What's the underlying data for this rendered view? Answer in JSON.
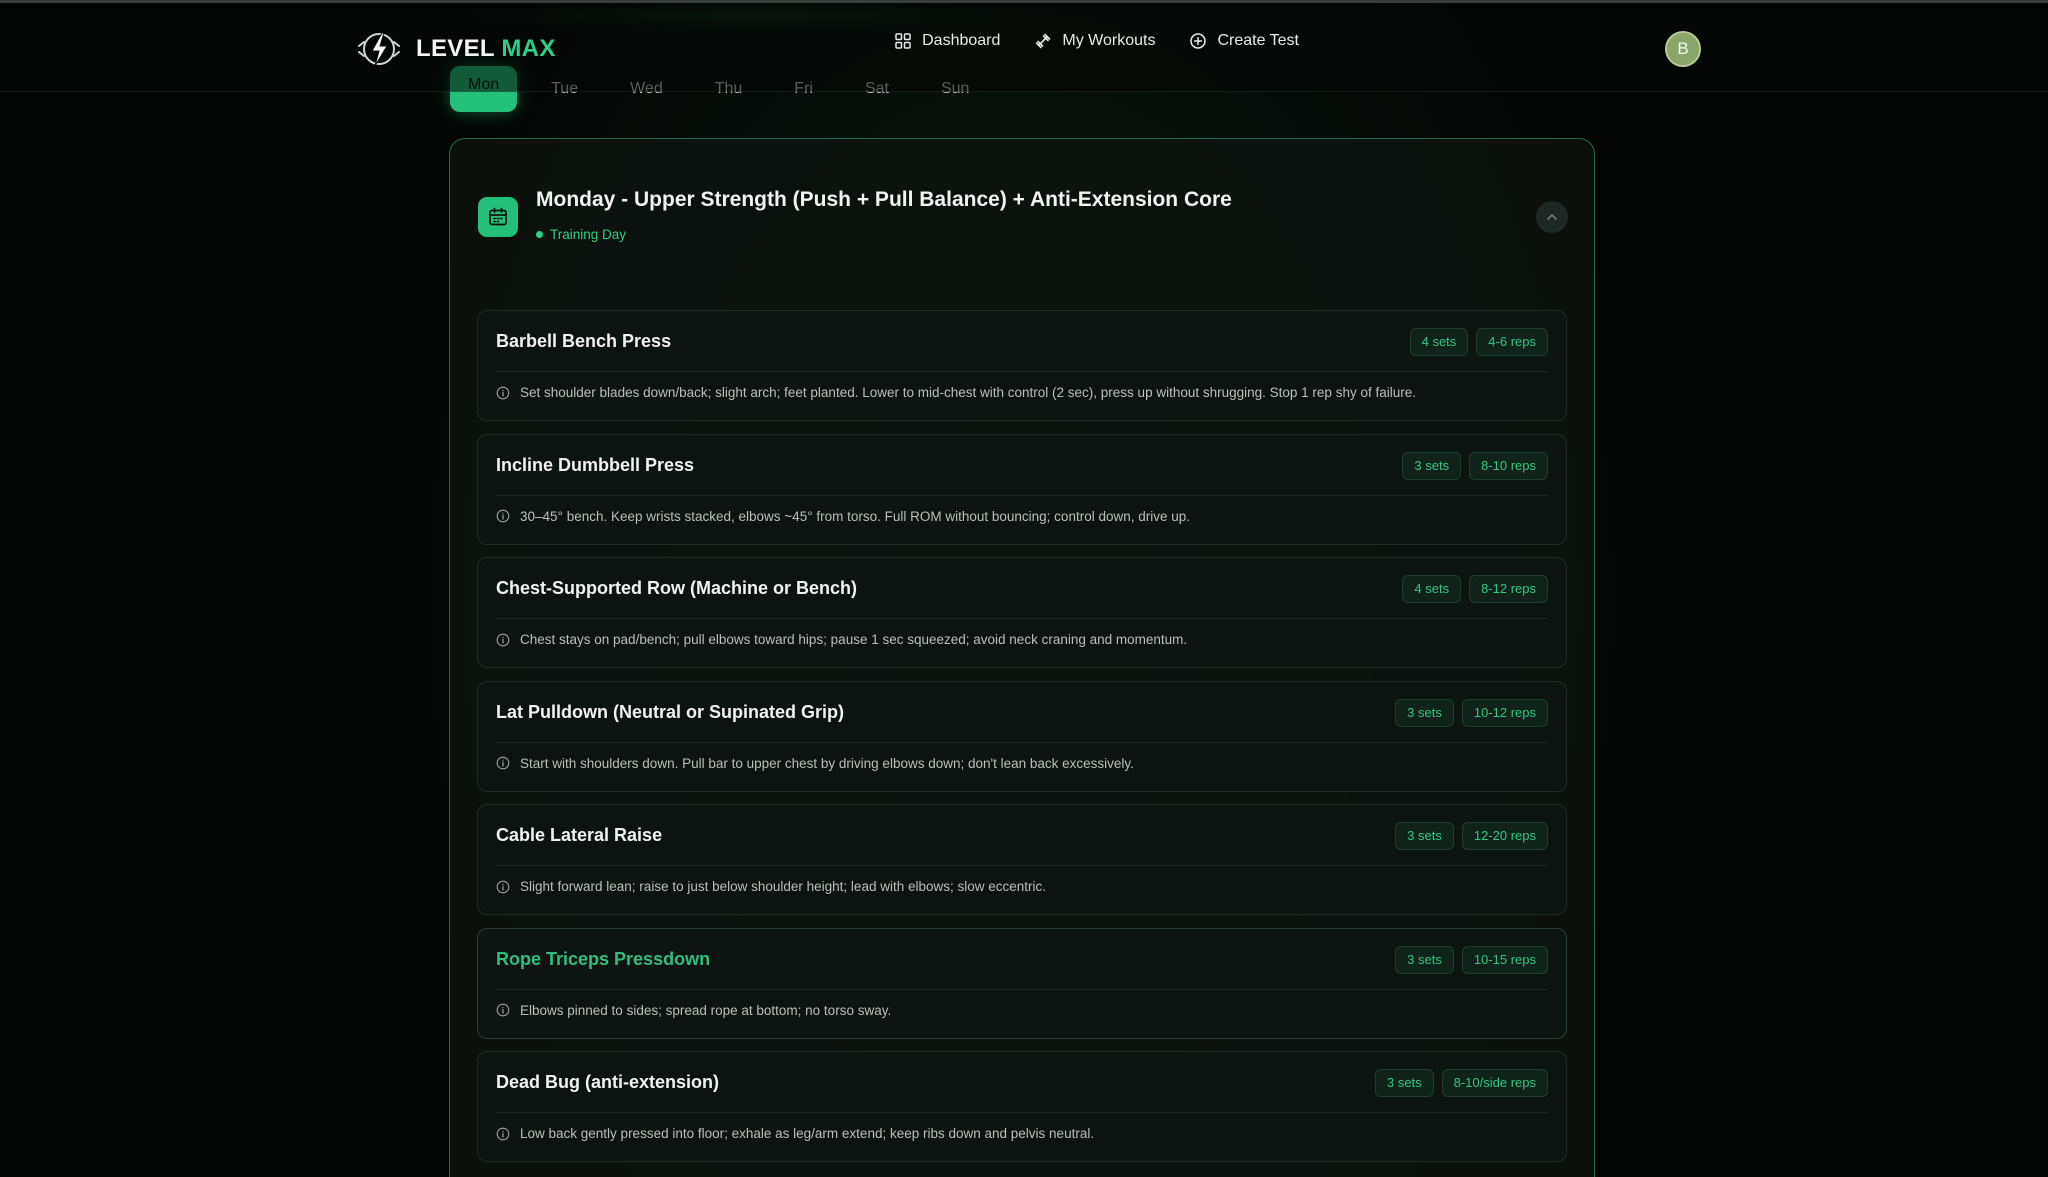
{
  "brand": {
    "name_part1": "LEVEL",
    "name_part2": "MAX"
  },
  "nav": [
    {
      "label": "Dashboard",
      "icon": "grid-icon"
    },
    {
      "label": "My Workouts",
      "icon": "dumbbell-icon"
    },
    {
      "label": "Create Test",
      "icon": "plus-circle-icon"
    }
  ],
  "user": {
    "initial": "B"
  },
  "tabs": [
    "Mon",
    "Tue",
    "Wed",
    "Thu",
    "Fri",
    "Sat",
    "Sun"
  ],
  "active_tab": "Mon",
  "day": {
    "title": "Monday - Upper Strength (Push + Pull Balance) + Anti-Extension Core",
    "status": "Training Day"
  },
  "exercises": [
    {
      "name": "Barbell Bench Press",
      "sets": "4 sets",
      "reps": "4-6 reps",
      "note": "Set shoulder blades down/back; slight arch; feet planted. Lower to mid-chest with control (2 sec), press up without shrugging. Stop 1 rep shy of failure."
    },
    {
      "name": "Incline Dumbbell Press",
      "sets": "3 sets",
      "reps": "8-10 reps",
      "note": "30–45° bench. Keep wrists stacked, elbows ~45° from torso. Full ROM without bouncing; control down, drive up."
    },
    {
      "name": "Chest-Supported Row (Machine or Bench)",
      "sets": "4 sets",
      "reps": "8-12 reps",
      "note": "Chest stays on pad/bench; pull elbows toward hips; pause 1 sec squeezed; avoid neck craning and momentum."
    },
    {
      "name": "Lat Pulldown (Neutral or Supinated Grip)",
      "sets": "3 sets",
      "reps": "10-12 reps",
      "note": "Start with shoulders down. Pull bar to upper chest by driving elbows down; don't lean back excessively."
    },
    {
      "name": "Cable Lateral Raise",
      "sets": "3 sets",
      "reps": "12-20 reps",
      "note": "Slight forward lean; raise to just below shoulder height; lead with elbows; slow eccentric."
    },
    {
      "name": "Rope Triceps Pressdown",
      "sets": "3 sets",
      "reps": "10-15 reps",
      "note": "Elbows pinned to sides; spread rope at bottom; no torso sway."
    },
    {
      "name": "Dead Bug (anti-extension)",
      "sets": "3 sets",
      "reps": "8-10/side reps",
      "note": "Low back gently pressed into floor; exhale as leg/arm extend; keep ribs down and pelvis neutral."
    }
  ],
  "colors": {
    "accent": "#22c07a",
    "accent_text": "#2ecf86",
    "background": "#030504",
    "card_border": "#1f6b48"
  }
}
